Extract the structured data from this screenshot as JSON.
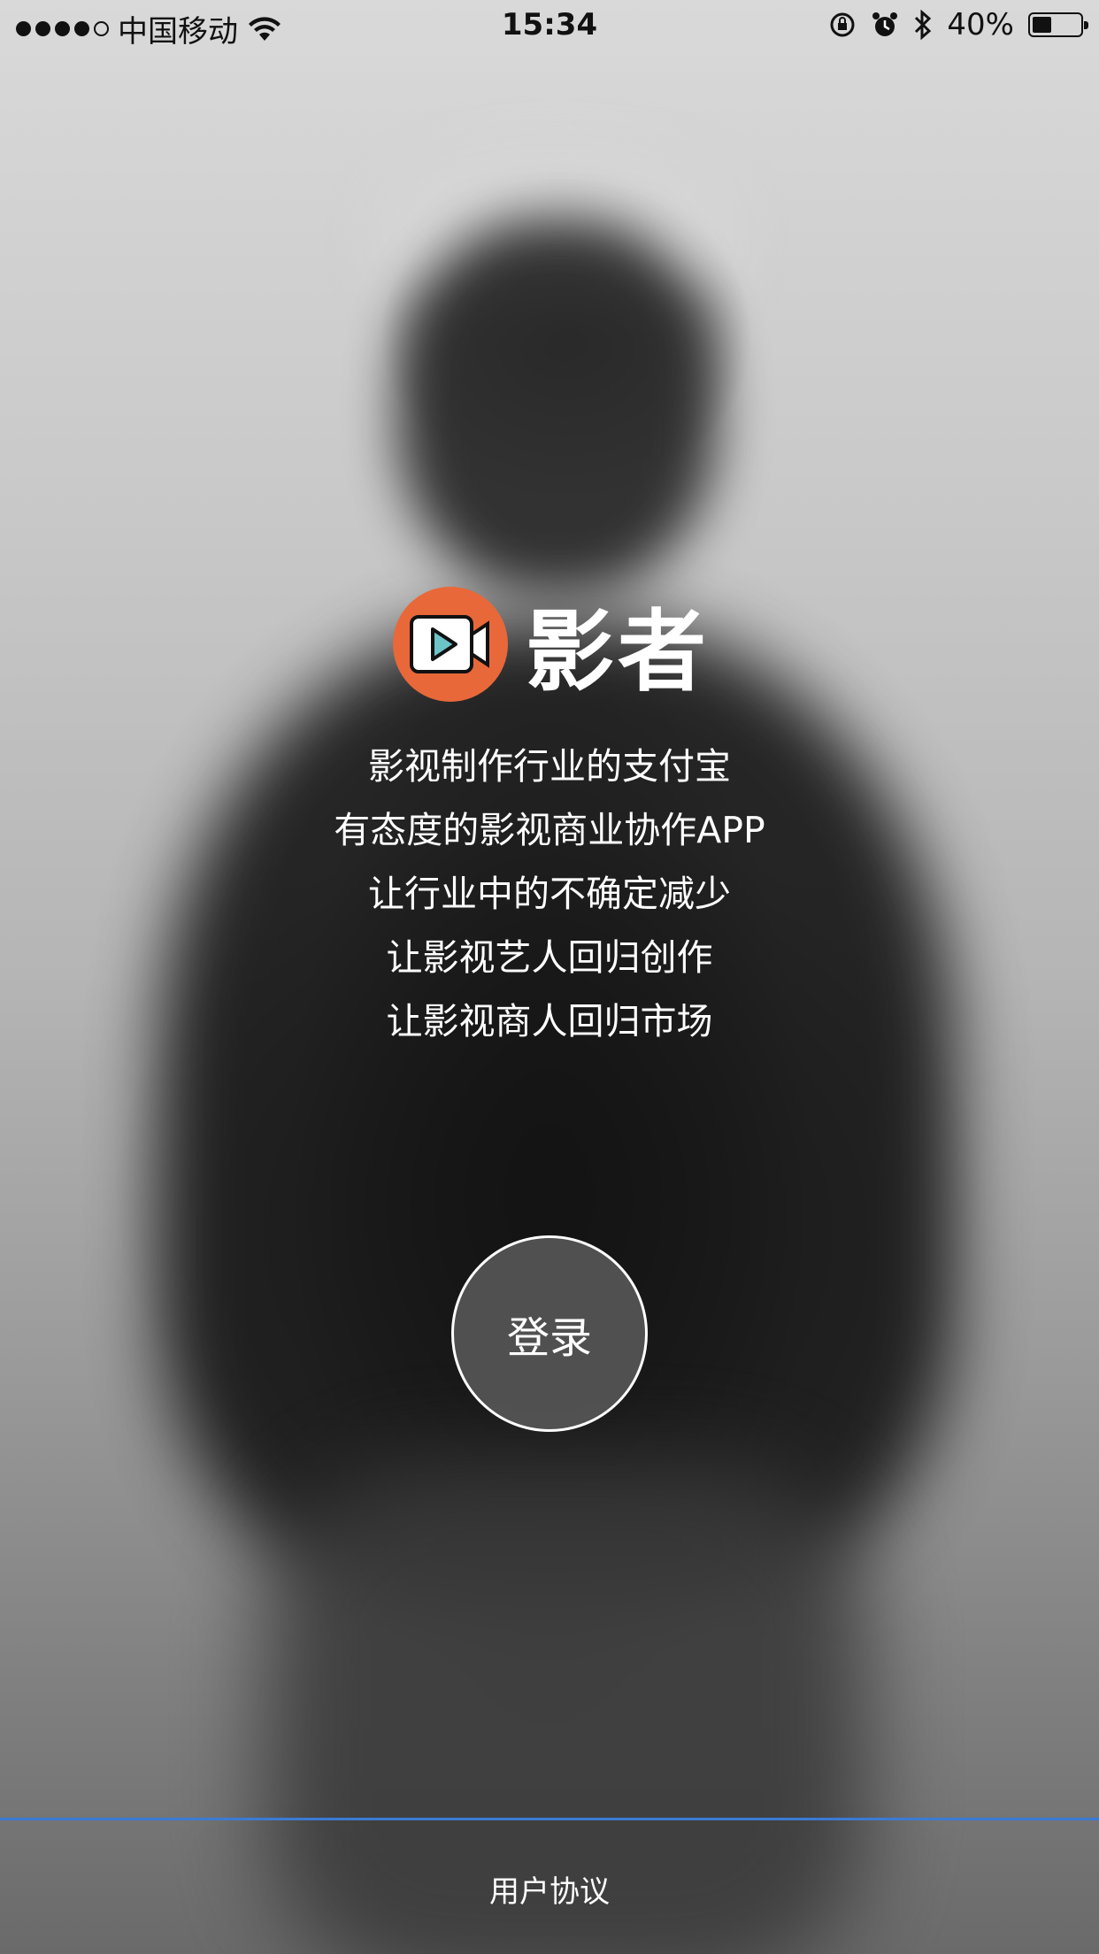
{
  "status_bar": {
    "carrier": "中国移动",
    "time": "15:34",
    "battery_text": "40%",
    "battery_level": 0.4,
    "signal_bars_filled": 4,
    "signal_bars_total": 5,
    "icons": [
      "wifi-icon",
      "rotation-lock-icon",
      "alarm-icon",
      "bluetooth-icon",
      "battery-icon"
    ]
  },
  "app": {
    "name": "影者",
    "logo_color": "#e8683a",
    "logo_icon": "video-camera-icon"
  },
  "slogans": [
    "影视制作行业的支付宝",
    "有态度的影视商业协作APP",
    "让行业中的不确定减少",
    "让影视艺人回归创作",
    "让影视商人回归市场"
  ],
  "login_button": {
    "label": "登录"
  },
  "footer": {
    "agreement_link": "用户协议",
    "divider_color": "#3a7bd5"
  }
}
